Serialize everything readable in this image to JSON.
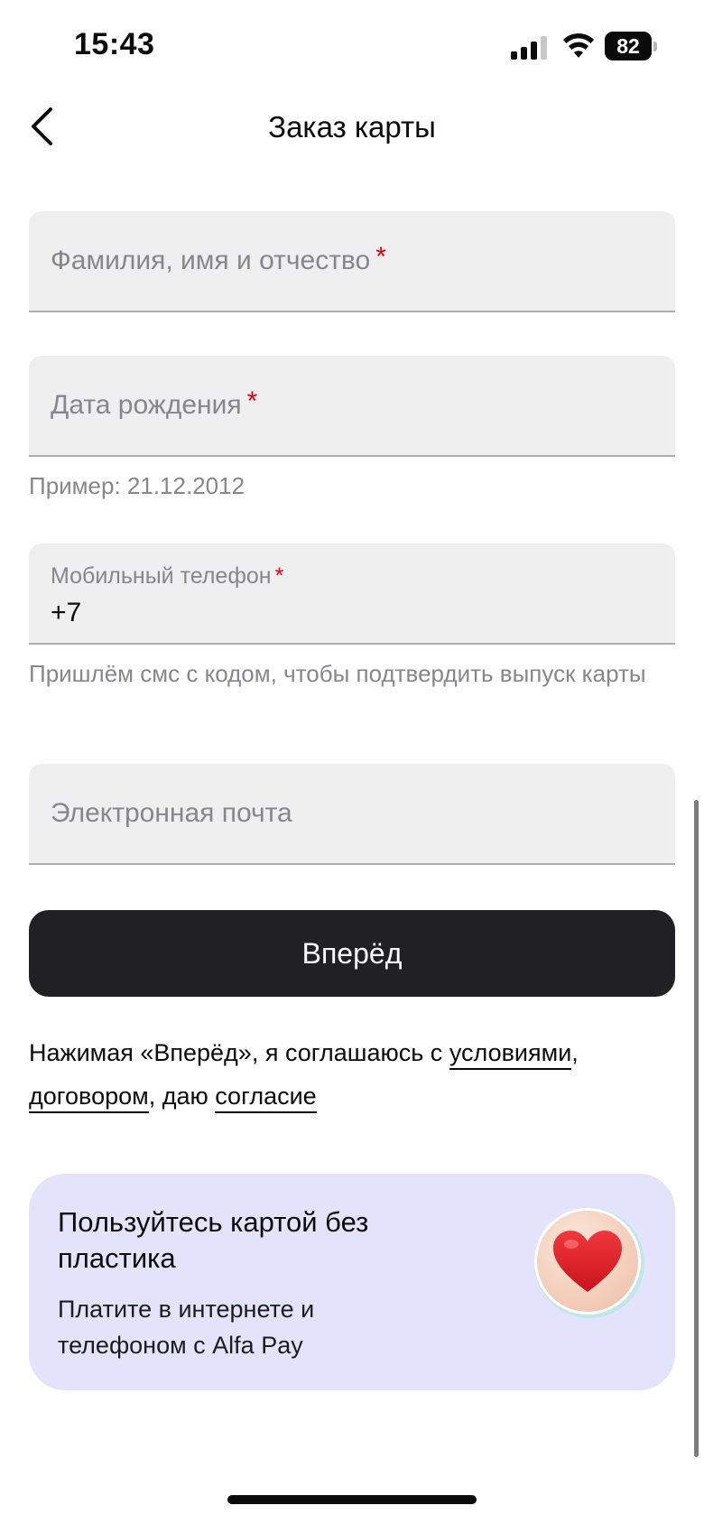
{
  "status_bar": {
    "time": "15:43",
    "battery": "82"
  },
  "nav": {
    "title": "Заказ карты"
  },
  "form": {
    "full_name": {
      "placeholder": "Фамилия, имя и отчество",
      "required_mark": "*"
    },
    "birth_date": {
      "placeholder": "Дата рождения",
      "required_mark": "*",
      "hint": "Пример: 21.12.2012"
    },
    "phone": {
      "label": "Мобильный телефон",
      "required_mark": "*",
      "value": "+7",
      "hint": "Пришлём смс с кодом, чтобы подтвердить выпуск карты"
    },
    "email": {
      "placeholder": "Электронная почта"
    }
  },
  "submit": {
    "label": "Вперёд"
  },
  "consent": {
    "prefix": "Нажимая «Вперёд», я соглашаюсь с",
    "link_terms": "условиями",
    "comma": ",",
    "link_contract": "договором",
    "middle": ", даю",
    "link_agreement": "согласие"
  },
  "promo": {
    "title": "Пользуйтесь картой без пластика",
    "text": "Платите в интернете и телефоном с Alfa Pay",
    "icon": "heart-icon"
  },
  "colors": {
    "background": "#ffffff",
    "field_bg": "#efeff0",
    "required": "#e3000f",
    "button_bg": "#212124",
    "promo_bg": "#e3e4fb",
    "heart": "#e41f23"
  }
}
